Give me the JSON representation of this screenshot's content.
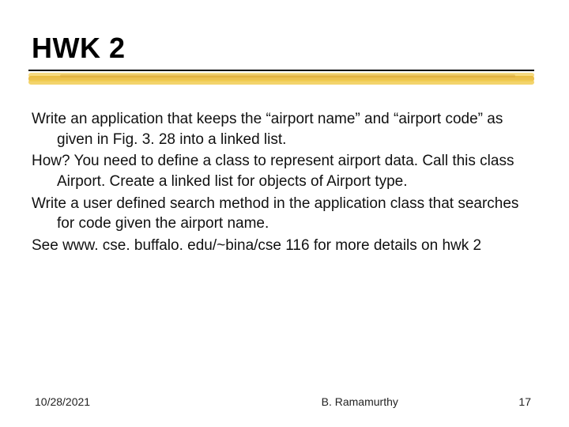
{
  "title": "HWK 2",
  "body": {
    "p1": "Write an application that keeps the “airport name” and “airport code” as given in Fig. 3. 28 into a linked list.",
    "p2": "How? You need to define a class to represent airport data. Call this class Airport. Create a linked list for objects of Airport type.",
    "p3": "Write a user defined search method in the application class that searches for code given the airport name.",
    "p4": "See www. cse. buffalo. edu/~bina/cse 116 for more details on hwk 2"
  },
  "footer": {
    "date": "10/28/2021",
    "author": "B. Ramamurthy",
    "page": "17"
  }
}
